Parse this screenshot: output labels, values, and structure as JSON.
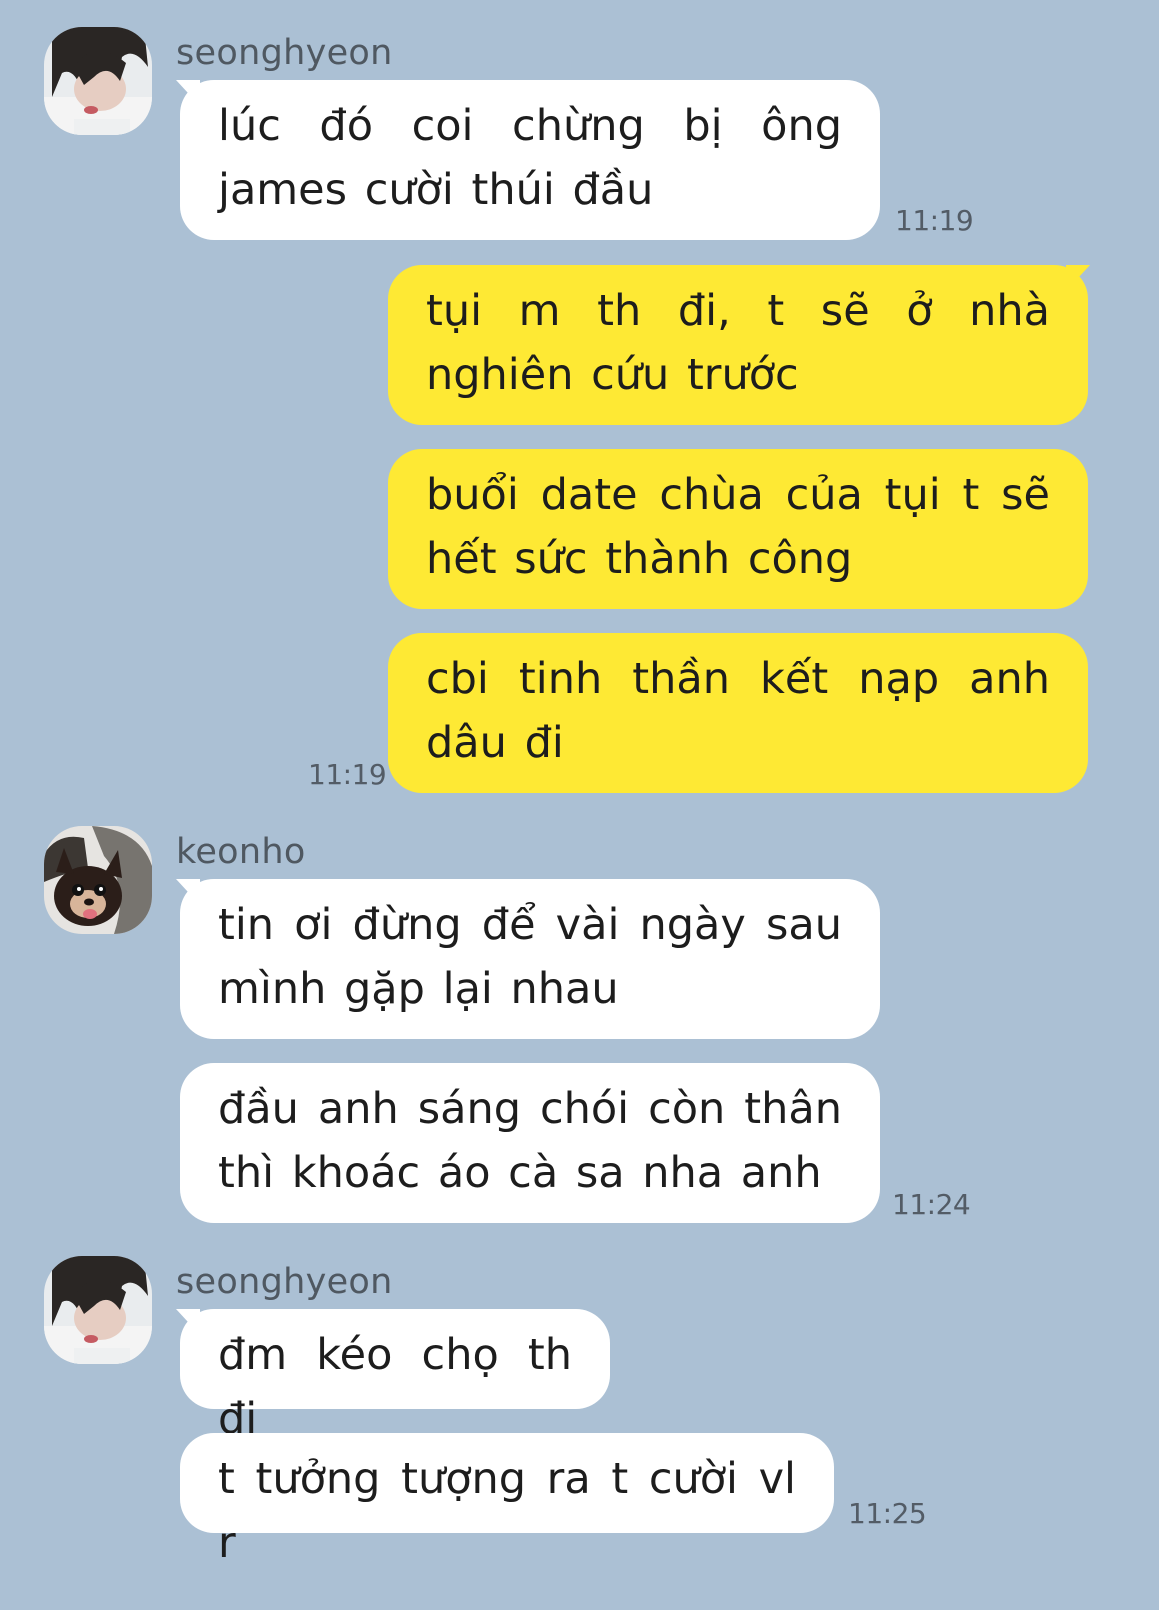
{
  "colors": {
    "background": "#abc0d4",
    "incoming_bubble": "#ffffff",
    "outgoing_bubble": "#fee934",
    "text": "#1d1d1d",
    "meta_text": "#535c66"
  },
  "messages": [
    {
      "sender": "seonghyeon",
      "direction": "incoming",
      "avatar_icon": "seonghyeon-avatar-icon",
      "bubbles": [
        "lúc đó coi chừng bị ông james cười thúi đầu"
      ],
      "time": "11:19"
    },
    {
      "sender": "",
      "direction": "outgoing",
      "bubbles": [
        "tụi m th đi, t sẽ ở nhà nghiên cứu trước",
        "buổi date chùa của tụi t sẽ hết sức thành công",
        "cbi tinh thần kết nạp anh dâu đi"
      ],
      "time": "11:19"
    },
    {
      "sender": "keonho",
      "direction": "incoming",
      "avatar_icon": "keonho-avatar-icon",
      "bubbles": [
        "tin ơi đừng để vài ngày sau mình gặp lại nhau",
        "đầu anh sáng chói còn thân thì khoác áo cà sa nha anh"
      ],
      "time": "11:24"
    },
    {
      "sender": "seonghyeon",
      "direction": "incoming",
      "avatar_icon": "seonghyeon-avatar-icon",
      "bubbles": [
        "đm kéo chọ th đi",
        "t tưởng tượng ra t cười vl r"
      ],
      "time": "11:25"
    }
  ]
}
